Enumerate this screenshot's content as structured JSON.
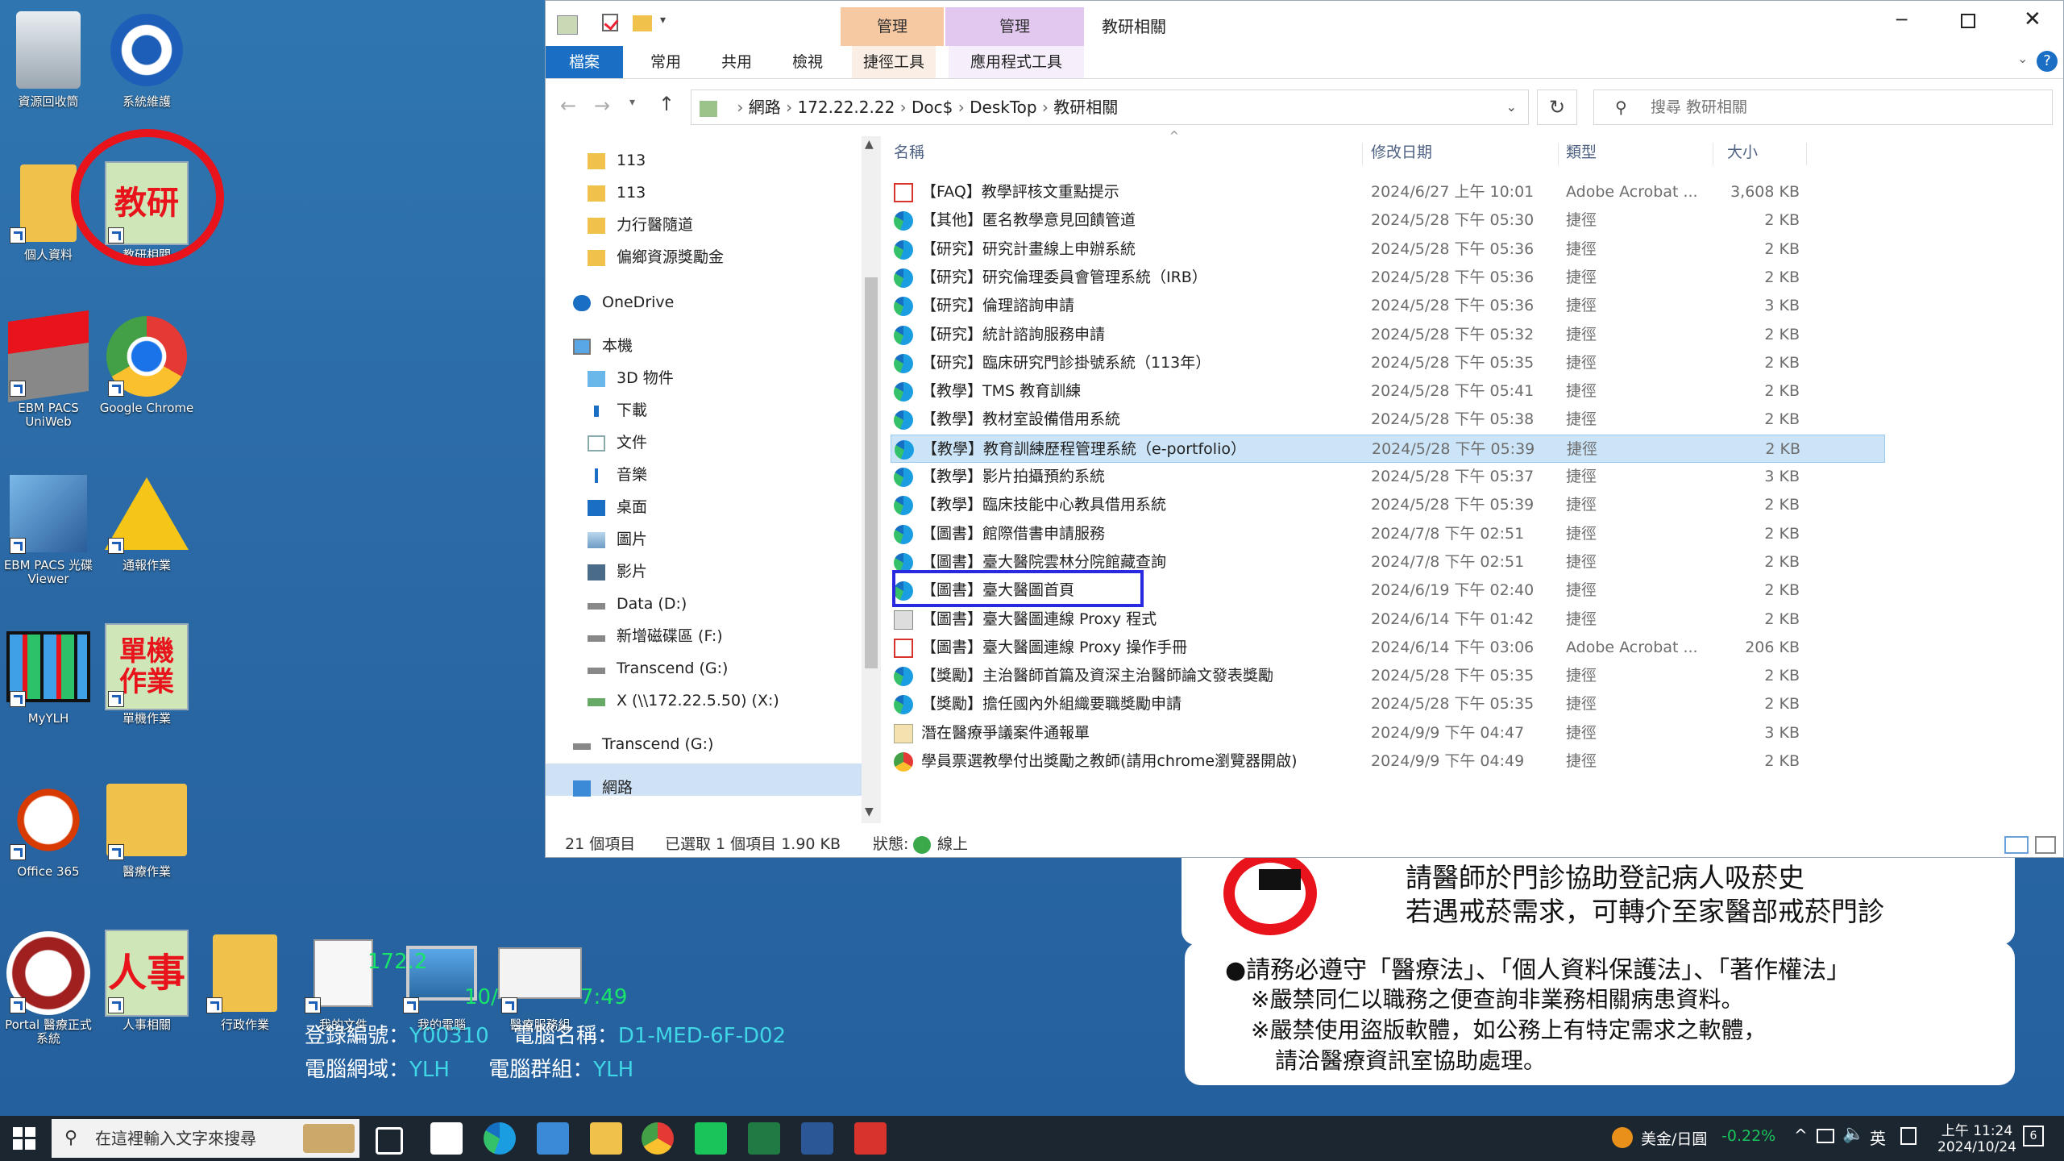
{
  "desktop": {
    "icons": [
      {
        "label": "資源回收筒",
        "icon": "recycle-bin-icon"
      },
      {
        "label": "系統維護",
        "icon": "gear-icon"
      },
      {
        "label": "個人資料",
        "icon": "folder-icon"
      },
      {
        "label": "教研相關",
        "icon": "jiaoyan-icon",
        "glyph": "教研"
      },
      {
        "label": "EBM PACS UniWeb",
        "icon": "pacs-icon"
      },
      {
        "label": "Google Chrome",
        "icon": "chrome-icon"
      },
      {
        "label": "EBM PACS 光碟 Viewer",
        "icon": "pacs-viewer-icon"
      },
      {
        "label": "通報作業",
        "icon": "warning-icon"
      },
      {
        "label": "MyYLH",
        "icon": "myylh-icon"
      },
      {
        "label": "單機作業",
        "icon": "standalone-icon",
        "glyph": "單機作業"
      },
      {
        "label": "Office 365",
        "icon": "office-icon"
      },
      {
        "label": "醫療作業",
        "icon": "medical-folder-icon"
      },
      {
        "label": "Portal 醫療正式系統",
        "icon": "portal-icon"
      },
      {
        "label": "人事相關",
        "icon": "hr-icon",
        "glyph": "人事"
      },
      {
        "label": "行政作業",
        "icon": "admin-folder-icon"
      },
      {
        "label": "我的文件",
        "icon": "documents-icon"
      },
      {
        "label": "我的電腦",
        "icon": "computer-icon"
      },
      {
        "label": "醫療服務組",
        "icon": "service-icon"
      }
    ],
    "info_lines": {
      "ip_fragment": "172.2",
      "date_fragment": "10/",
      "time_fragment": "7:49",
      "asset_label": "登錄編號：",
      "asset_value": "Y00310",
      "name_label": "電腦名稱：",
      "name_value": "D1-MED-6F-D02",
      "domain_label": "電腦網域：",
      "domain_value": "YLH",
      "group_label": "電腦群組：",
      "group_value": "YLH"
    },
    "notice": {
      "line1": "請醫師於門診協助登記病人吸菸史",
      "line2": "若遇戒菸需求，可轉介至家醫部戒菸門診"
    },
    "rules": {
      "line1": "●請務必遵守「醫療法」、「個人資料保護法」、「著作權法」",
      "line2": "※嚴禁同仁以職務之便查詢非業務相關病患資料。",
      "line3": "※嚴禁使用盜版軟體，如公務上有特定需求之軟體，",
      "line4": "請洽醫療資訊室協助處理。"
    }
  },
  "explorer": {
    "title": "教研相關",
    "context_tabs": [
      "管理",
      "管理"
    ],
    "context_subtabs": [
      "捷徑工具",
      "應用程式工具"
    ],
    "ribbon_tabs": [
      "檔案",
      "常用",
      "共用",
      "檢視"
    ],
    "breadcrumb": [
      "網路",
      "172.22.2.22",
      "Doc$",
      "DeskTop",
      "教研相關"
    ],
    "search_placeholder": "搜尋 教研相關",
    "nav_items": [
      {
        "label": "113",
        "icon": "folder-icon",
        "indent": 1
      },
      {
        "label": "113",
        "icon": "folder-icon",
        "indent": 1
      },
      {
        "label": "力行醫隨道",
        "icon": "folder-icon",
        "indent": 1
      },
      {
        "label": "偏鄉資源獎勵金",
        "icon": "folder-icon",
        "indent": 1
      },
      {
        "label": "OneDrive",
        "icon": "cloud-icon",
        "indent": 0
      },
      {
        "label": "本機",
        "icon": "computer-icon",
        "indent": 0
      },
      {
        "label": "3D 物件",
        "icon": "cube-icon",
        "indent": 1
      },
      {
        "label": "下載",
        "icon": "download-icon",
        "indent": 1
      },
      {
        "label": "文件",
        "icon": "document-icon",
        "indent": 1
      },
      {
        "label": "音樂",
        "icon": "music-icon",
        "indent": 1
      },
      {
        "label": "桌面",
        "icon": "desktop-icon",
        "indent": 1
      },
      {
        "label": "圖片",
        "icon": "picture-icon",
        "indent": 1
      },
      {
        "label": "影片",
        "icon": "video-icon",
        "indent": 1
      },
      {
        "label": "Data (D:)",
        "icon": "drive-icon",
        "indent": 1
      },
      {
        "label": "新增磁碟區 (F:)",
        "icon": "drive-icon",
        "indent": 1
      },
      {
        "label": "Transcend (G:)",
        "icon": "drive-icon",
        "indent": 1
      },
      {
        "label": "X (\\\\172.22.5.50) (X:)",
        "icon": "network-drive-icon",
        "indent": 1
      },
      {
        "label": "Transcend (G:)",
        "icon": "drive-icon",
        "indent": 0
      },
      {
        "label": "網路",
        "icon": "network-icon",
        "indent": 0
      }
    ],
    "columns": [
      "名稱",
      "修改日期",
      "類型",
      "大小"
    ],
    "files": [
      {
        "name": "【FAQ】教學評核文重點提示",
        "date": "2024/6/27 上午 10:01",
        "type": "Adobe Acrobat ...",
        "size": "3,608 KB",
        "icon": "pdf-icon"
      },
      {
        "name": "【其他】匿名教學意見回饋管道",
        "date": "2024/5/28 下午 05:30",
        "type": "捷徑",
        "size": "2 KB",
        "icon": "edge-icon"
      },
      {
        "name": "【研究】研究計畫線上申辦系統",
        "date": "2024/5/28 下午 05:36",
        "type": "捷徑",
        "size": "2 KB",
        "icon": "edge-icon"
      },
      {
        "name": "【研究】研究倫理委員會管理系統（IRB）",
        "date": "2024/5/28 下午 05:36",
        "type": "捷徑",
        "size": "2 KB",
        "icon": "edge-icon"
      },
      {
        "name": "【研究】倫理諮詢申請",
        "date": "2024/5/28 下午 05:36",
        "type": "捷徑",
        "size": "3 KB",
        "icon": "edge-icon"
      },
      {
        "name": "【研究】統計諮詢服務申請",
        "date": "2024/5/28 下午 05:32",
        "type": "捷徑",
        "size": "2 KB",
        "icon": "edge-icon"
      },
      {
        "name": "【研究】臨床研究門診掛號系統（113年）",
        "date": "2024/5/28 下午 05:35",
        "type": "捷徑",
        "size": "2 KB",
        "icon": "edge-icon"
      },
      {
        "name": "【教學】TMS 教育訓練",
        "date": "2024/5/28 下午 05:41",
        "type": "捷徑",
        "size": "2 KB",
        "icon": "edge-icon"
      },
      {
        "name": "【教學】教材室設備借用系統",
        "date": "2024/5/28 下午 05:38",
        "type": "捷徑",
        "size": "2 KB",
        "icon": "edge-icon"
      },
      {
        "name": "【教學】教育訓練歷程管理系統（e-portfolio）",
        "date": "2024/5/28 下午 05:39",
        "type": "捷徑",
        "size": "2 KB",
        "icon": "edge-icon"
      },
      {
        "name": "【教學】影片拍攝預約系統",
        "date": "2024/5/28 下午 05:37",
        "type": "捷徑",
        "size": "3 KB",
        "icon": "edge-icon"
      },
      {
        "name": "【教學】臨床技能中心教具借用系統",
        "date": "2024/5/28 下午 05:39",
        "type": "捷徑",
        "size": "2 KB",
        "icon": "edge-icon"
      },
      {
        "name": "【圖書】館際借書申請服務",
        "date": "2024/7/8 下午 02:51",
        "type": "捷徑",
        "size": "2 KB",
        "icon": "edge-icon"
      },
      {
        "name": "【圖書】臺大醫院雲林分院館藏查詢",
        "date": "2024/7/8 下午 02:51",
        "type": "捷徑",
        "size": "2 KB",
        "icon": "edge-icon"
      },
      {
        "name": "【圖書】臺大醫圖首頁",
        "date": "2024/6/19 下午 02:40",
        "type": "捷徑",
        "size": "2 KB",
        "icon": "edge-icon"
      },
      {
        "name": "【圖書】臺大醫圖連線 Proxy 程式",
        "date": "2024/6/14 下午 01:42",
        "type": "捷徑",
        "size": "2 KB",
        "icon": "proxy-icon"
      },
      {
        "name": "【圖書】臺大醫圖連線 Proxy 操作手冊",
        "date": "2024/6/14 下午 03:06",
        "type": "Adobe Acrobat ...",
        "size": "206 KB",
        "icon": "pdf-icon"
      },
      {
        "name": "【獎勵】主治醫師首篇及資深主治醫師論文發表獎勵",
        "date": "2024/5/28 下午 05:35",
        "type": "捷徑",
        "size": "2 KB",
        "icon": "edge-icon"
      },
      {
        "name": "【獎勵】擔任國內外組織要職獎勵申請",
        "date": "2024/5/28 下午 05:35",
        "type": "捷徑",
        "size": "2 KB",
        "icon": "edge-icon"
      },
      {
        "name": "潛在醫療爭議案件通報單",
        "date": "2024/9/9 下午 04:47",
        "type": "捷徑",
        "size": "3 KB",
        "icon": "form-icon"
      },
      {
        "name": "學員票選教學付出獎勵之教師(請用chrome瀏覽器開啟)",
        "date": "2024/9/9 下午 04:49",
        "type": "捷徑",
        "size": "2 KB",
        "icon": "chrome-icon"
      }
    ],
    "selected_index": 9,
    "status": {
      "count": "21 個項目",
      "selected": "已選取 1 個項目  1.90 KB",
      "state_label": "狀態:",
      "state_value": "線上"
    }
  },
  "taskbar": {
    "search_placeholder": "在這裡輸入文字來搜尋",
    "stock_label": "美金/日圓",
    "stock_value": "-0.22%",
    "ime": "英",
    "time": "上午 11:24",
    "date": "2024/10/24",
    "notification_count": "6"
  },
  "colors": {
    "accent": "#1a6fc4",
    "selection": "#cce4f7",
    "highlight_circle": "#e8131b",
    "highlight_box": "#2929e0",
    "info_green": "#19e56a",
    "desktop_text_cyan": "#3fd6e6"
  }
}
